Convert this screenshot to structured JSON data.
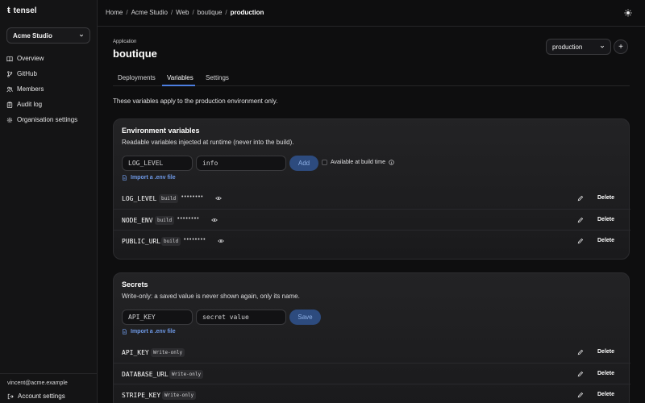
{
  "app": {
    "name": "tensel"
  },
  "sidebar": {
    "org": "Acme Studio",
    "items": [
      {
        "label": "Overview",
        "icon": "book-icon"
      },
      {
        "label": "GitHub",
        "icon": "git-branch-icon"
      },
      {
        "label": "Members",
        "icon": "users-icon"
      },
      {
        "label": "Audit log",
        "icon": "clipboard-icon"
      },
      {
        "label": "Organisation settings",
        "icon": "gear-icon"
      }
    ],
    "user_email": "vincent@acme.example",
    "account_label": "Account settings"
  },
  "breadcrumb": [
    "Home",
    "Acme Studio",
    "Web",
    "boutique",
    "production"
  ],
  "header": {
    "label": "Application",
    "title": "boutique",
    "environment": "production",
    "add_env_symbol": "+"
  },
  "tabs": [
    {
      "label": "Deployments",
      "active": false
    },
    {
      "label": "Variables",
      "active": true
    },
    {
      "label": "Settings",
      "active": false
    }
  ],
  "intro": "These variables apply to the production environment only.",
  "env_card": {
    "title": "Environment variables",
    "description": "Readable variables injected at runtime (never into the build).",
    "key_placeholder": "LOG_LEVEL",
    "value_placeholder": "info",
    "add_label": "Add",
    "build_time_label": "Available at build time",
    "import_label": "Import a .env file",
    "rows": [
      {
        "name": "LOG_LEVEL",
        "badge": "build",
        "masked": "••••••••"
      },
      {
        "name": "NODE_ENV",
        "badge": "build",
        "masked": "••••••••"
      },
      {
        "name": "PUBLIC_URL",
        "badge": "build",
        "masked": "••••••••"
      }
    ]
  },
  "secrets_card": {
    "title": "Secrets",
    "description": "Write-only: a saved value is never shown again, only its name.",
    "key_placeholder": "API_KEY",
    "value_placeholder": "secret value",
    "save_label": "Save",
    "import_label": "Import a .env file",
    "rows": [
      {
        "name": "API_KEY",
        "badge": "Write-only"
      },
      {
        "name": "DATABASE_URL",
        "badge": "Write-only"
      },
      {
        "name": "STRIPE_KEY",
        "badge": "Write-only"
      }
    ]
  },
  "delete_label": "Delete",
  "colors": {
    "accent": "#4c7ee0",
    "link": "#6f9ae8",
    "primary_button": "#2d4b7e",
    "background": "#0e0e0f"
  }
}
